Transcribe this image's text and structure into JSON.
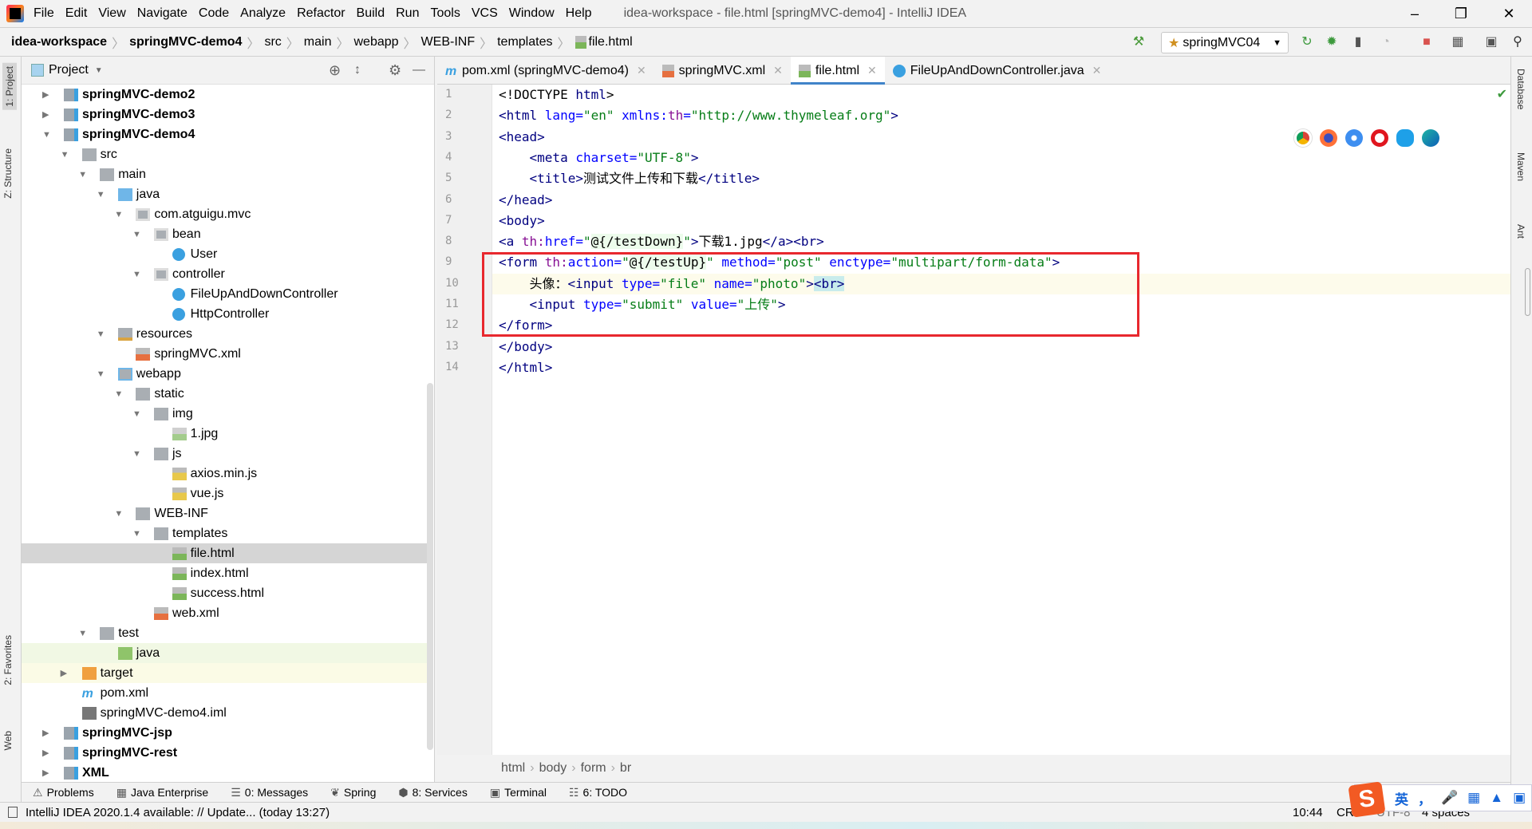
{
  "menubar": {
    "items": [
      "File",
      "Edit",
      "View",
      "Navigate",
      "Code",
      "Analyze",
      "Refactor",
      "Build",
      "Run",
      "Tools",
      "VCS",
      "Window",
      "Help"
    ],
    "window_title": "idea-workspace - file.html [springMVC-demo4] - IntelliJ IDEA"
  },
  "navbar": {
    "crumbs": [
      "idea-workspace",
      "springMVC-demo4",
      "src",
      "main",
      "webapp",
      "WEB-INF",
      "templates",
      "file.html"
    ],
    "run_config": "springMVC04"
  },
  "left_strip": {
    "project": "1: Project",
    "structure": "Z: Structure",
    "favorites": "2: Favorites",
    "web": "Web"
  },
  "right_strip": {
    "database": "Database",
    "maven": "Maven",
    "ant": "Ant"
  },
  "project": {
    "title": "Project",
    "tree": [
      {
        "label": "springMVC-demo2",
        "depth": 0,
        "arrow": "collapsed",
        "icon": "module",
        "bold": true
      },
      {
        "label": "springMVC-demo3",
        "depth": 0,
        "arrow": "collapsed",
        "icon": "module",
        "bold": true
      },
      {
        "label": "springMVC-demo4",
        "depth": 0,
        "arrow": "expanded",
        "icon": "module",
        "bold": true
      },
      {
        "label": "src",
        "depth": 1,
        "arrow": "expanded",
        "icon": "folder"
      },
      {
        "label": "main",
        "depth": 2,
        "arrow": "expanded",
        "icon": "folder"
      },
      {
        "label": "java",
        "depth": 3,
        "arrow": "expanded",
        "icon": "source-folder"
      },
      {
        "label": "com.atguigu.mvc",
        "depth": 4,
        "arrow": "expanded",
        "icon": "package"
      },
      {
        "label": "bean",
        "depth": 5,
        "arrow": "expanded",
        "icon": "package"
      },
      {
        "label": "User",
        "depth": 6,
        "icon": "class"
      },
      {
        "label": "controller",
        "depth": 5,
        "arrow": "expanded",
        "icon": "package"
      },
      {
        "label": "FileUpAndDownController",
        "depth": 6,
        "icon": "class"
      },
      {
        "label": "HttpController",
        "depth": 6,
        "icon": "class"
      },
      {
        "label": "resources",
        "depth": 3,
        "arrow": "expanded",
        "icon": "resources-folder"
      },
      {
        "label": "springMVC.xml",
        "depth": 4,
        "icon": "spring-xml"
      },
      {
        "label": "webapp",
        "depth": 3,
        "arrow": "expanded",
        "icon": "web-folder"
      },
      {
        "label": "static",
        "depth": 4,
        "arrow": "expanded",
        "icon": "folder"
      },
      {
        "label": "img",
        "depth": 5,
        "arrow": "expanded",
        "icon": "folder"
      },
      {
        "label": "1.jpg",
        "depth": 6,
        "icon": "image"
      },
      {
        "label": "js",
        "depth": 5,
        "arrow": "expanded",
        "icon": "folder"
      },
      {
        "label": "axios.min.js",
        "depth": 6,
        "icon": "js"
      },
      {
        "label": "vue.js",
        "depth": 6,
        "icon": "js"
      },
      {
        "label": "WEB-INF",
        "depth": 4,
        "arrow": "expanded",
        "icon": "folder"
      },
      {
        "label": "templates",
        "depth": 5,
        "arrow": "expanded",
        "icon": "folder"
      },
      {
        "label": "file.html",
        "depth": 6,
        "icon": "html",
        "selected": true
      },
      {
        "label": "index.html",
        "depth": 6,
        "icon": "html"
      },
      {
        "label": "success.html",
        "depth": 6,
        "icon": "html"
      },
      {
        "label": "web.xml",
        "depth": 5,
        "icon": "xml"
      },
      {
        "label": "test",
        "depth": 2,
        "arrow": "expanded",
        "icon": "folder"
      },
      {
        "label": "java",
        "depth": 3,
        "icon": "test-folder",
        "highlight": "green"
      },
      {
        "label": "target",
        "depth": 1,
        "arrow": "collapsed",
        "icon": "excluded-folder",
        "highlight": "yellow"
      },
      {
        "label": "pom.xml",
        "depth": 1,
        "icon": "maven"
      },
      {
        "label": "springMVC-demo4.iml",
        "depth": 1,
        "icon": "iml"
      },
      {
        "label": "springMVC-jsp",
        "depth": 0,
        "arrow": "collapsed",
        "icon": "module",
        "bold": true
      },
      {
        "label": "springMVC-rest",
        "depth": 0,
        "arrow": "collapsed",
        "icon": "module",
        "bold": true
      },
      {
        "label": "XML",
        "depth": 0,
        "arrow": "collapsed",
        "icon": "module",
        "bold": true
      }
    ]
  },
  "tabs": [
    {
      "label": "pom.xml (springMVC-demo4)",
      "icon": "maven"
    },
    {
      "label": "springMVC.xml",
      "icon": "spring-xml"
    },
    {
      "label": "file.html",
      "icon": "html",
      "active": true
    },
    {
      "label": "FileUpAndDownController.java",
      "icon": "class"
    }
  ],
  "editor": {
    "current_line": 10,
    "lines": [
      [
        [
          "<!DOCTYPE ",
          "t-pl"
        ],
        [
          "html",
          "t-tag"
        ],
        [
          ">",
          "t-pl"
        ]
      ],
      [
        [
          "<html ",
          "t-tag"
        ],
        [
          "lang=",
          "t-attr"
        ],
        [
          "\"en\" ",
          "t-val"
        ],
        [
          "xmlns:",
          "t-attr"
        ],
        [
          "th",
          "t-th"
        ],
        [
          "=",
          "t-attr"
        ],
        [
          "\"http://www.thymeleaf.org\"",
          "t-val"
        ],
        [
          ">",
          "t-tag"
        ]
      ],
      [
        [
          "<head>",
          "t-tag"
        ]
      ],
      [
        [
          "    <meta ",
          "t-tag"
        ],
        [
          "charset=",
          "t-attr"
        ],
        [
          "\"UTF-8\"",
          "t-val"
        ],
        [
          ">",
          "t-tag"
        ]
      ],
      [
        [
          "    <title>",
          "t-tag"
        ],
        [
          "测试文件上传和下载",
          "t-pl"
        ],
        [
          "</title>",
          "t-tag"
        ]
      ],
      [
        [
          "</head>",
          "t-tag"
        ]
      ],
      [
        [
          "<body>",
          "t-tag"
        ]
      ],
      [
        [
          "<a ",
          "t-tag"
        ],
        [
          "th:",
          "t-th"
        ],
        [
          "href=",
          "t-attr"
        ],
        [
          "\"",
          "t-val"
        ],
        [
          "@{/testDown}",
          "t-hlv"
        ],
        [
          "\"",
          "t-val"
        ],
        [
          ">",
          "t-tag"
        ],
        [
          "下载1.jpg",
          "t-pl"
        ],
        [
          "</a><br>",
          "t-tag"
        ]
      ],
      [
        [
          "<form ",
          "t-tag"
        ],
        [
          "th:",
          "t-th"
        ],
        [
          "action=",
          "t-attr"
        ],
        [
          "\"",
          "t-val"
        ],
        [
          "@{/testUp}",
          "t-hlv"
        ],
        [
          "\" ",
          "t-val"
        ],
        [
          "method=",
          "t-attr"
        ],
        [
          "\"post\" ",
          "t-val"
        ],
        [
          "enctype=",
          "t-attr"
        ],
        [
          "\"multipart/form-data\"",
          "t-val"
        ],
        [
          ">",
          "t-tag"
        ]
      ],
      [
        [
          "    头像：",
          "t-pl"
        ],
        [
          "<input ",
          "t-tag"
        ],
        [
          "type=",
          "t-attr"
        ],
        [
          "\"file\" ",
          "t-val"
        ],
        [
          "name=",
          "t-attr"
        ],
        [
          "\"photo\"",
          "t-val"
        ],
        [
          ">",
          "t-tag"
        ],
        [
          "<br>",
          "t-br"
        ]
      ],
      [
        [
          "    <input ",
          "t-tag"
        ],
        [
          "type=",
          "t-attr"
        ],
        [
          "\"submit\" ",
          "t-val"
        ],
        [
          "value=",
          "t-attr"
        ],
        [
          "\"上传\"",
          "t-val"
        ],
        [
          ">",
          "t-tag"
        ]
      ],
      [
        [
          "</form>",
          "t-tag"
        ]
      ],
      [
        [
          "</body>",
          "t-tag"
        ]
      ],
      [
        [
          "</html>",
          "t-tag"
        ]
      ]
    ]
  },
  "editor_breadcrumb": [
    "html",
    "body",
    "form",
    "br"
  ],
  "tool_windows": [
    {
      "label": "Problems",
      "icon": "warning"
    },
    {
      "label": "Java Enterprise",
      "icon": "java-ee"
    },
    {
      "label": "0: Messages",
      "icon": "messages"
    },
    {
      "label": "Spring",
      "icon": "spring"
    },
    {
      "label": "8: Services",
      "icon": "services"
    },
    {
      "label": "Terminal",
      "icon": "terminal"
    },
    {
      "label": "6: TODO",
      "icon": "todo"
    }
  ],
  "status": {
    "message": "IntelliJ IDEA 2020.1.4 available: // Update... (today 13:27)",
    "position": "10:44",
    "line_sep": "CRLF",
    "encoding": "UTF-8",
    "indent": "4 spaces"
  },
  "ime": {
    "mode": "英",
    "punct": "，"
  }
}
